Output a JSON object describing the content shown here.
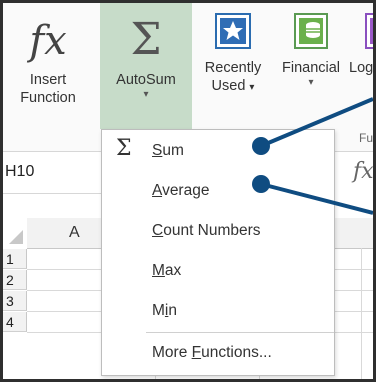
{
  "ribbon": {
    "insert_function": {
      "line1": "Insert",
      "line2": "Function",
      "icon": "fx-icon"
    },
    "autosum": {
      "label": "AutoSum",
      "caret": "▾",
      "icon": "sigma-icon"
    },
    "recently_used": {
      "line1": "Recently",
      "line2": "Used",
      "caret": "▾",
      "icon": "star-icon"
    },
    "financial": {
      "label": "Financial",
      "caret": "▾",
      "icon": "money-icon"
    },
    "logical": {
      "label": "Log",
      "icon": "logical-icon"
    },
    "group_label": "Fun"
  },
  "namebox": {
    "value": "H10"
  },
  "formula_bar": {
    "fx": "fx"
  },
  "grid": {
    "column_a": "A",
    "rows": [
      "1",
      "2",
      "3",
      "4"
    ]
  },
  "menu": {
    "items": [
      {
        "pre": "",
        "u": "S",
        "post": "um",
        "icon": "sigma-icon"
      },
      {
        "pre": "",
        "u": "A",
        "post": "verage"
      },
      {
        "pre": "",
        "u": "C",
        "post": "ount Numbers"
      },
      {
        "pre": "",
        "u": "M",
        "post": "ax"
      },
      {
        "pre": "M",
        "u": "i",
        "post": "n"
      },
      {
        "pre": "More ",
        "u": "F",
        "post": "unctions..."
      }
    ]
  },
  "colors": {
    "autosum_highlight": "#c7dcc9",
    "callout": "#0f4c81"
  }
}
